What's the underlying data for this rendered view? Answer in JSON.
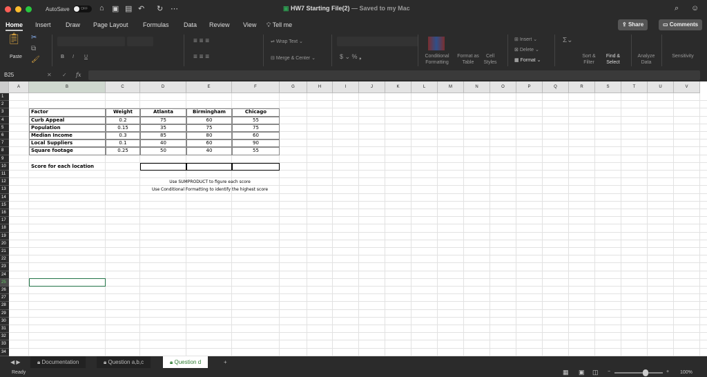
{
  "titlebar": {
    "autosave": "AutoSave",
    "toggle": "OFF",
    "doc_title": "HW7 Starting File(2)",
    "saved": " — Saved to my Mac"
  },
  "tabs": [
    "Home",
    "Insert",
    "Draw",
    "Page Layout",
    "Formulas",
    "Data",
    "Review",
    "View",
    "Tell me"
  ],
  "share": "Share",
  "comments": "Comments",
  "ribbon": {
    "paste": "Paste",
    "wrap": "Wrap Text",
    "merge": "Merge & Center",
    "cond": "Conditional Formatting",
    "fmt_table": "Format as Table",
    "cell_styles": "Cell Styles",
    "insert": "Insert",
    "delete": "Delete",
    "format": "Format",
    "sort": "Sort & Filter",
    "find": "Find & Select",
    "analyze": "Analyze Data",
    "sensitivity": "Sensitivity"
  },
  "formula_bar": {
    "name_box": "B25",
    "fx": "fx",
    "value": ""
  },
  "columns": [
    "A",
    "B",
    "C",
    "D",
    "E",
    "F",
    "G",
    "H",
    "I",
    "J",
    "K",
    "L",
    "M",
    "N",
    "O",
    "P",
    "Q",
    "R",
    "S",
    "T",
    "U",
    "V"
  ],
  "table": {
    "header": [
      "Factor",
      "Weight",
      "Atlanta",
      "Birmingham",
      "Chicago"
    ],
    "rows": [
      [
        "Curb Appeal",
        "0.2",
        "75",
        "60",
        "55"
      ],
      [
        "Population",
        "0.15",
        "35",
        "75",
        "75"
      ],
      [
        "Median Income",
        "0.3",
        "85",
        "80",
        "60"
      ],
      [
        "Local Suppliers",
        "0.1",
        "40",
        "60",
        "90"
      ],
      [
        "Square footage",
        "0.25",
        "50",
        "40",
        "55"
      ]
    ]
  },
  "score_label": "Score for each location",
  "notes": [
    "Use SUMPRODUCT to figure each score",
    "Use Conditional Formatting to identify the highest score"
  ],
  "selected_cell": "B25",
  "sheets": [
    "Documentation",
    "Question a,b,c",
    "Question d"
  ],
  "active_sheet": "Question d",
  "status": "Ready",
  "zoom": "100%",
  "zoom_percent": 100
}
